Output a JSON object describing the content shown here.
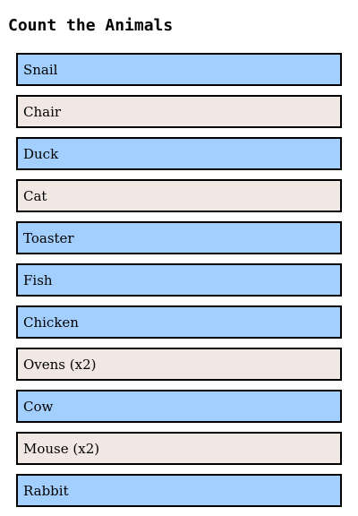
{
  "header": {
    "title": "Count the Animals"
  },
  "colors": {
    "animal_fill": "#a3cfff",
    "object_fill": "#f2e8e3",
    "border": "#000000"
  },
  "items": [
    {
      "label": "Snail",
      "kind": "animal"
    },
    {
      "label": "Chair",
      "kind": "object"
    },
    {
      "label": "Duck",
      "kind": "animal"
    },
    {
      "label": "Cat",
      "kind": "object"
    },
    {
      "label": "Toaster",
      "kind": "animal"
    },
    {
      "label": "Fish",
      "kind": "animal"
    },
    {
      "label": "Chicken",
      "kind": "animal"
    },
    {
      "label": "Ovens (x2)",
      "kind": "object"
    },
    {
      "label": "Cow",
      "kind": "animal"
    },
    {
      "label": "Mouse (x2)",
      "kind": "object"
    },
    {
      "label": "Rabbit",
      "kind": "animal"
    }
  ]
}
